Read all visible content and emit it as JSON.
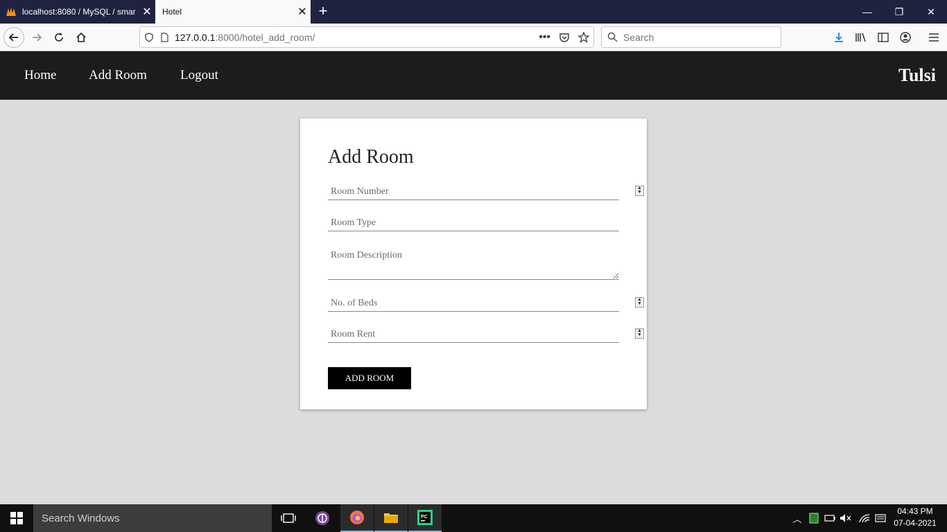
{
  "browser": {
    "tabs": [
      {
        "title": "localhost:8080 / MySQL / smar",
        "active": false
      },
      {
        "title": "Hotel",
        "active": true
      }
    ],
    "url": {
      "host": "127.0.0.1",
      "rest": ":8000/hotel_add_room/"
    },
    "search_placeholder": "Search"
  },
  "site": {
    "nav": [
      "Home",
      "Add Room",
      "Logout"
    ],
    "brand": "Tulsi"
  },
  "form": {
    "heading": "Add Room",
    "fields": {
      "room_number": "Room Number",
      "room_type": "Room Type",
      "room_description": "Room Description",
      "beds": "No. of Beds",
      "rent": "Room Rent"
    },
    "submit": "ADD ROOM"
  },
  "taskbar": {
    "search_placeholder": "Search Windows",
    "time": "04:43 PM",
    "date": "07-04-2021"
  }
}
